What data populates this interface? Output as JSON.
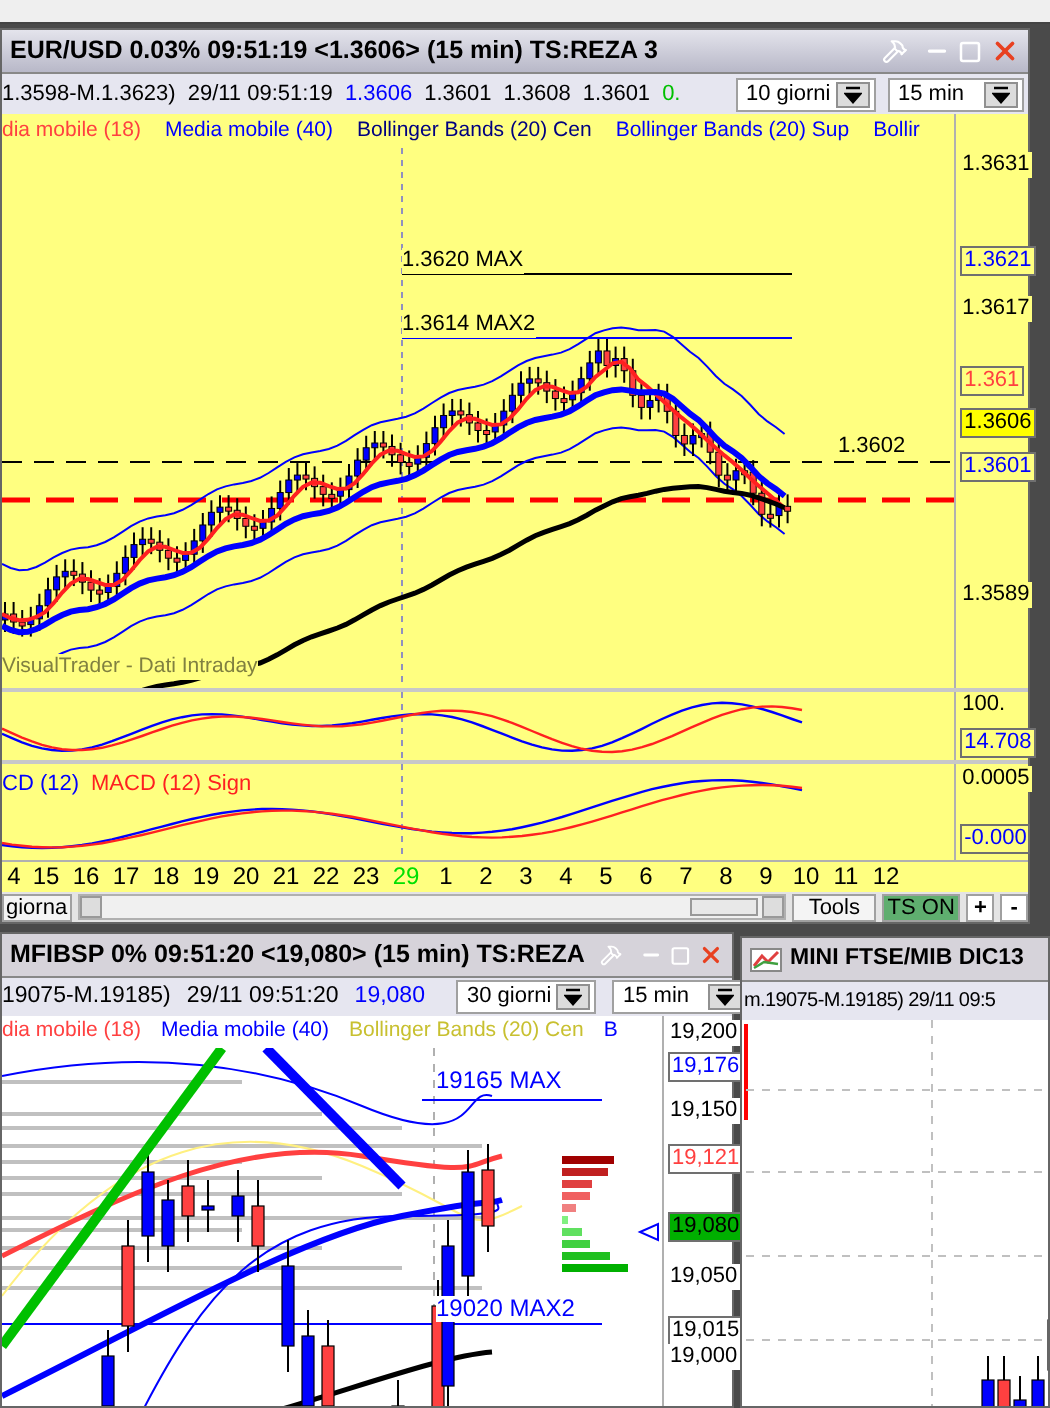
{
  "main_window": {
    "title": "EUR/USD 0.03% 09:51:19  <1.3606> (15 min) TS:REZA 3",
    "info": [
      {
        "text": "1.3598-M.1.3623)",
        "color": "#000000"
      },
      {
        "text": "29/11 09:51:19",
        "color": "#000000"
      },
      {
        "text": "1.3606",
        "color": "#0000ff"
      },
      {
        "text": "1.3601",
        "color": "#000000"
      },
      {
        "text": "1.3608",
        "color": "#000000"
      },
      {
        "text": "1.3601",
        "color": "#000000"
      },
      {
        "text": "0.",
        "color": "#00c000"
      }
    ],
    "selects": [
      {
        "value": "10 giorni"
      },
      {
        "value": "15 min"
      }
    ],
    "legend": [
      {
        "label": "dia mobile (18)",
        "color": "#ff4040"
      },
      {
        "label": "Media mobile (40)",
        "color": "#0000ff"
      },
      {
        "label": "Bollinger Bands (20) Cen",
        "color": "#000080"
      },
      {
        "label": "Bollinger Bands (20) Sup",
        "color": "#0000ff"
      },
      {
        "label": "Bollir",
        "color": "#0000ff"
      }
    ],
    "levels": [
      {
        "text": "1.3620 MAX"
      },
      {
        "text": "1.3614 MAX2"
      },
      {
        "text": "1.3602"
      }
    ],
    "price_labels": [
      {
        "text": "1.3631",
        "kind": "plain",
        "color": "#000000"
      },
      {
        "text": "1.3621",
        "kind": "boxed",
        "color": "#0000ff"
      },
      {
        "text": "1.3617",
        "kind": "plain",
        "color": "#000000"
      },
      {
        "text": "1.361",
        "kind": "boxed",
        "color": "#ff4040"
      },
      {
        "text": "1.3606",
        "kind": "current"
      },
      {
        "text": "1.3601",
        "kind": "boxed",
        "color": "#0000ff"
      },
      {
        "text": "1.3589",
        "kind": "plain",
        "color": "#000000"
      }
    ],
    "caption": "VisualTrader - Dati Intraday",
    "rsi_labels": [
      {
        "text": "100.",
        "kind": "plain",
        "color": "#000000"
      },
      {
        "text": "14.708",
        "kind": "boxed",
        "color": "#0000ff"
      }
    ],
    "macd_legend": [
      {
        "label": "CD (12)",
        "color": "#0000ff"
      },
      {
        "label": "MACD (12) Sign",
        "color": "#ff2020"
      }
    ],
    "macd_labels": [
      {
        "text": "0.0005",
        "kind": "plain",
        "color": "#000000"
      },
      {
        "text": "-0.000",
        "kind": "boxed",
        "color": "#0000ff"
      }
    ],
    "x_labels": [
      {
        "text": "4",
        "kind": "hour"
      },
      {
        "text": "15",
        "kind": "hour"
      },
      {
        "text": "16",
        "kind": "hour"
      },
      {
        "text": "17",
        "kind": "hour"
      },
      {
        "text": "18",
        "kind": "hour"
      },
      {
        "text": "19",
        "kind": "hour"
      },
      {
        "text": "20",
        "kind": "hour"
      },
      {
        "text": "21",
        "kind": "hour"
      },
      {
        "text": "22",
        "kind": "hour"
      },
      {
        "text": "23",
        "kind": "hour"
      },
      {
        "text": "29",
        "kind": "day"
      },
      {
        "text": "1",
        "kind": "hour"
      },
      {
        "text": "2",
        "kind": "hour"
      },
      {
        "text": "3",
        "kind": "hour"
      },
      {
        "text": "4",
        "kind": "hour"
      },
      {
        "text": "5",
        "kind": "hour"
      },
      {
        "text": "6",
        "kind": "hour"
      },
      {
        "text": "7",
        "kind": "hour"
      },
      {
        "text": "8",
        "kind": "hour"
      },
      {
        "text": "9",
        "kind": "hour"
      },
      {
        "text": "10",
        "kind": "hour"
      },
      {
        "text": "11",
        "kind": "hour"
      },
      {
        "text": "12",
        "kind": "hour"
      }
    ],
    "footer": {
      "left_button": "giorna",
      "tools": "Tools",
      "ts": {
        "label": "TS ON",
        "on": true
      },
      "zoom": [
        "+",
        "-"
      ]
    }
  },
  "second_window": {
    "title": "MFIBSP 0% 09:51:20  <19,080> (15 min) TS:REZA",
    "info": [
      {
        "text": "19075-M.19185)",
        "color": "#000000"
      },
      {
        "text": "29/11 09:51:20",
        "color": "#000000"
      },
      {
        "text": "19,080",
        "color": "#0000ff"
      }
    ],
    "selects": [
      {
        "value": "30 giorni"
      },
      {
        "value": "15 min"
      }
    ],
    "legend": [
      {
        "label": "dia mobile (18)",
        "color": "#ff4040"
      },
      {
        "label": "Media mobile (40)",
        "color": "#0000ff"
      },
      {
        "label": "Bollinger Bands (20) Cen",
        "color": "#c8c030"
      },
      {
        "label": "B",
        "color": "#0000ff"
      }
    ],
    "levels": [
      {
        "text": "19165 MAX"
      },
      {
        "text": "19020 MAX2"
      }
    ],
    "price_labels": [
      {
        "text": "19,200",
        "kind": "plain",
        "color": "#000000"
      },
      {
        "text": "19,176",
        "kind": "boxed",
        "color": "#0000ff"
      },
      {
        "text": "19,150",
        "kind": "plain",
        "color": "#000000"
      },
      {
        "text": "19,121",
        "kind": "boxed",
        "color": "#ff4040"
      },
      {
        "text": "19,080",
        "kind": "current"
      },
      {
        "text": "19,050",
        "kind": "plain",
        "color": "#000000"
      },
      {
        "text": "19,015",
        "kind": "boxed",
        "color": "#000000"
      },
      {
        "text": "19,000",
        "kind": "plain",
        "color": "#000000"
      }
    ]
  },
  "third_window": {
    "title": "MINI FTSE/MIB DIC13",
    "info": "m.19075-M.19185) 29/11 09:5"
  }
}
